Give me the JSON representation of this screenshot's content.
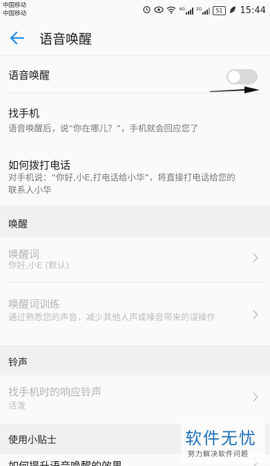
{
  "status_bar": {
    "carrier1": "中国移动",
    "carrier2": "中国移动",
    "sig1_label": "4G",
    "sig2_label": "2G",
    "battery": "51",
    "time": "15:44"
  },
  "header": {
    "title": "语音唤醒",
    "back_icon": "arrow-left-icon"
  },
  "settings": {
    "voice_wakeup": {
      "label": "语音唤醒",
      "enabled": false
    },
    "find_phone": {
      "title": "找手机",
      "desc": "语音唤醒后，说“你在哪儿？”，手机就会回应您了"
    },
    "make_call": {
      "title": "如何拨打电话",
      "desc": "对手机说：“你好,小E,打电话给小华”，将直接打电话给您的联系人小华"
    }
  },
  "sections": {
    "wakeup": {
      "header": "唤醒",
      "wake_word": {
        "title": "唤醒词",
        "value": "你好,小E (默认)"
      },
      "wake_training": {
        "title": "唤醒词训练",
        "desc": "通过熟悉您的声音，减少其他人声或噪音带来的误操作"
      }
    },
    "ringtone": {
      "header": "铃声",
      "response_ringtone": {
        "title": "找手机时的响应铃声",
        "value": "活泼"
      }
    },
    "tips": {
      "header": "使用小贴士",
      "improve": {
        "title": "如何提升语音唤醒的效果"
      }
    }
  },
  "watermark": {
    "brand": "软件无忧",
    "tagline": "努力解决软件问题"
  },
  "colors": {
    "accent": "#1e88e5",
    "section_bg": "#f0f0f0",
    "toggle_off": "#d9d9d9",
    "watermark_blue": "#1e6fb8"
  }
}
